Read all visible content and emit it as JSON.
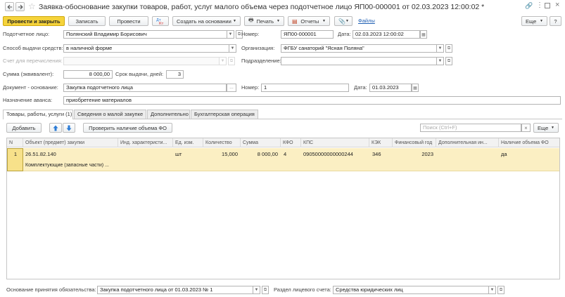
{
  "window": {
    "title": "Заявка-обоснование закупки товаров, работ, услуг малого объема через подотчетное лицо ЯП00-000001 от 02.03.2023 12:00:02 *"
  },
  "toolbar": {
    "post_close": "Провести и закрыть",
    "save": "Записать",
    "post": "Провести",
    "create_based": "Создать на основании",
    "print": "Печать",
    "reports": "Отчеты",
    "files": "Файлы",
    "more": "Еще",
    "help": "?"
  },
  "form": {
    "accountable_label": "Подотчетное лицо:",
    "accountable_value": "Полянский Владимир Борисович",
    "number_label": "Номер:",
    "number_value": "ЯП00-000001",
    "date_label": "Дата:",
    "date_value": "02.03.2023 12:00:02",
    "method_label": "Способ выдачи средств:",
    "method_value": "в наличной форме",
    "org_label": "Организация:",
    "org_value": "ФГБУ санаторий \"Ясная Поляна\"",
    "account_label": "Счет для перечисления:",
    "division_label": "Подразделение:",
    "sum_label": "Сумма (эквивалент):",
    "sum_value": "8 000,00",
    "term_label": "Срок выдачи, дней:",
    "term_value": "3",
    "basis_label": "Документ - основание:",
    "basis_value": "Закупка подотчетного лица",
    "basis_number_label": "Номер:",
    "basis_number_value": "1",
    "basis_date_label": "Дата:",
    "basis_date_value": "01.03.2023",
    "purpose_label": "Назначение аванса:",
    "purpose_value": "приобретение материалов"
  },
  "tabs": [
    {
      "label": "Товары, работы, услуги (1)"
    },
    {
      "label": "Сведения о малой закупке"
    },
    {
      "label": "Дополнительно"
    },
    {
      "label": "Бухгалтерская операция"
    }
  ],
  "table_toolbar": {
    "add": "Добавить",
    "check_fo": "Проверить наличие объема ФО",
    "search_placeholder": "Поиск (Ctrl+F)",
    "more": "Еще"
  },
  "table": {
    "columns": [
      "N",
      "Объект (предмет) закупки",
      "Инд. характеристи...",
      "Ед. изм.",
      "Количество",
      "Сумма",
      "КФО",
      "КПС",
      "КЭК",
      "Финансовый год",
      "Дополнительная ин...",
      "Наличие объема ФО"
    ],
    "rows": [
      {
        "n": "1",
        "object": "26.51.82.140",
        "object_desc": "Комплектующие (запасные части) ...",
        "ind": "",
        "unit": "шт",
        "qty": "15,000",
        "sum": "8 000,00",
        "kfo": "4",
        "kps": "09050000000000244",
        "kek": "346",
        "year": "2023",
        "extra": "",
        "fo": "да"
      }
    ]
  },
  "footer": {
    "obligation_label": "Основание принятия обязательства:",
    "obligation_value": "Закупка подотчетного лица от 01.03.2023 № 1",
    "section_label": "Раздел лицевого счета:",
    "section_value": "Средства юридических лиц"
  },
  "colors": {
    "primary_button": "#f5d33a",
    "row_highlight": "#fbefc3",
    "link": "#1f5fb3",
    "arrow_blue": "#2b7bd6"
  }
}
